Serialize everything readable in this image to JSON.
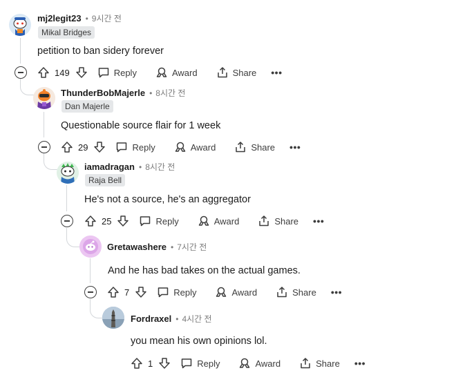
{
  "comments": [
    {
      "username": "mj2legit23",
      "time": "9시간 전",
      "flair": "Mikal Bridges",
      "body": "petition to ban sidery forever",
      "score": "149",
      "reply": "Reply",
      "award": "Award",
      "share": "Share",
      "more": "•••",
      "avatar": "snoo-avatar-blue"
    },
    {
      "username": "ThunderBobMajerle",
      "time": "8시간 전",
      "flair": "Dan Majerle",
      "body": "Questionable source flair for 1 week",
      "score": "29",
      "reply": "Reply",
      "award": "Award",
      "share": "Share",
      "more": "•••",
      "avatar": "snoo-avatar-orange"
    },
    {
      "username": "iamadragan",
      "time": "8시간 전",
      "flair": "Raja Bell",
      "body": "He's not a source, he's an aggregator",
      "score": "25",
      "reply": "Reply",
      "award": "Award",
      "share": "Share",
      "more": "•••",
      "avatar": "snoo-avatar-green"
    },
    {
      "username": "Gretawashere",
      "time": "7시간 전",
      "flair": "",
      "body": "And he has bad takes on the actual games.",
      "score": "7",
      "reply": "Reply",
      "award": "Award",
      "share": "Share",
      "more": "•••",
      "avatar": "snoo-avatar-purple"
    },
    {
      "username": "Fordraxel",
      "time": "4시간 전",
      "flair": "",
      "body": "you mean his own opinions lol.",
      "score": "1",
      "reply": "Reply",
      "award": "Award",
      "share": "Share",
      "more": "•••",
      "avatar": "photo-avatar"
    }
  ],
  "separator": "•",
  "colors": {
    "thread_line": "#d3d6da",
    "flair_bg": "#e5e7e9",
    "meta_text": "#7c7c7c"
  }
}
